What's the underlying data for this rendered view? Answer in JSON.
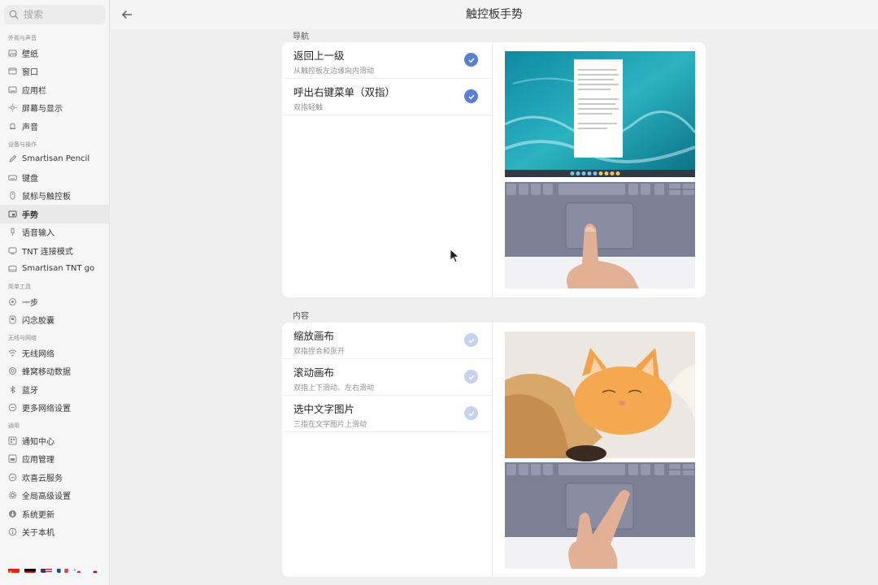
{
  "sidebar": {
    "search_placeholder": "搜索",
    "sections": [
      {
        "title": "外观与声音",
        "items": [
          {
            "label": "壁纸",
            "icon": "wallpaper-icon"
          },
          {
            "label": "窗口",
            "icon": "window-icon"
          },
          {
            "label": "应用栏",
            "icon": "app-bar-icon"
          },
          {
            "label": "屏幕与显示",
            "icon": "brightness-icon"
          },
          {
            "label": "声音",
            "icon": "bell-icon"
          }
        ]
      },
      {
        "title": "设备与操作",
        "items": [
          {
            "label": "Smartisan Pencil",
            "icon": "pencil-icon"
          },
          {
            "label": "键盘",
            "icon": "keyboard-icon"
          },
          {
            "label": "鼠标与触控板",
            "icon": "mouse-icon"
          },
          {
            "label": "手势",
            "icon": "gesture-icon",
            "active": true
          },
          {
            "label": "语音输入",
            "icon": "microphone-icon"
          },
          {
            "label": "TNT 连接模式",
            "icon": "monitor-icon"
          },
          {
            "label": "Smartisan TNT go",
            "icon": "tnt-go-icon"
          }
        ]
      },
      {
        "title": "简单工具",
        "items": [
          {
            "label": "一步",
            "icon": "one-step-icon"
          },
          {
            "label": "闪念胶囊",
            "icon": "capsule-icon"
          }
        ]
      },
      {
        "title": "无线与网络",
        "items": [
          {
            "label": "无线网络",
            "icon": "wifi-icon"
          },
          {
            "label": "蜂窝移动数据",
            "icon": "cellular-icon"
          },
          {
            "label": "蓝牙",
            "icon": "bluetooth-icon"
          },
          {
            "label": "更多网络设置",
            "icon": "more-icon"
          }
        ]
      },
      {
        "title": "通用",
        "items": [
          {
            "label": "通知中心",
            "icon": "notification-icon"
          },
          {
            "label": "应用管理",
            "icon": "apps-icon"
          },
          {
            "label": "欢喜云服务",
            "icon": "cloud-icon"
          },
          {
            "label": "全局高级设置",
            "icon": "gear-icon"
          },
          {
            "label": "系统更新",
            "icon": "update-icon"
          },
          {
            "label": "关于本机",
            "icon": "info-icon"
          }
        ]
      }
    ],
    "flags": [
      "china-flag-icon",
      "germany-flag-icon",
      "usa-flag-icon",
      "france-flag-icon",
      "korea-flag-icon",
      "japan-flag-icon"
    ]
  },
  "header": {
    "title": "触控板手势"
  },
  "groups": [
    {
      "label": "导航",
      "rows": [
        {
          "title": "返回上一级",
          "subtitle": "从触控板左边缘向内滑动",
          "checked": true
        },
        {
          "title": "呼出右键菜单（双指）",
          "subtitle": "双指轻触",
          "checked": true
        }
      ]
    },
    {
      "label": "内容",
      "rows": [
        {
          "title": "缩放画布",
          "subtitle": "双指捏合和张开",
          "checked": false
        },
        {
          "title": "滚动画布",
          "subtitle": "双指上下滑动、左右滑动",
          "checked": false
        },
        {
          "title": "选中文字图片",
          "subtitle": "三指在文字图片上滑动",
          "checked": false
        }
      ]
    }
  ],
  "colors": {
    "accent": "#5b7fd1",
    "accent_light": "#c6d2ef",
    "sidebar_bg": "#f6f6f6",
    "content_bg": "#efefef"
  }
}
